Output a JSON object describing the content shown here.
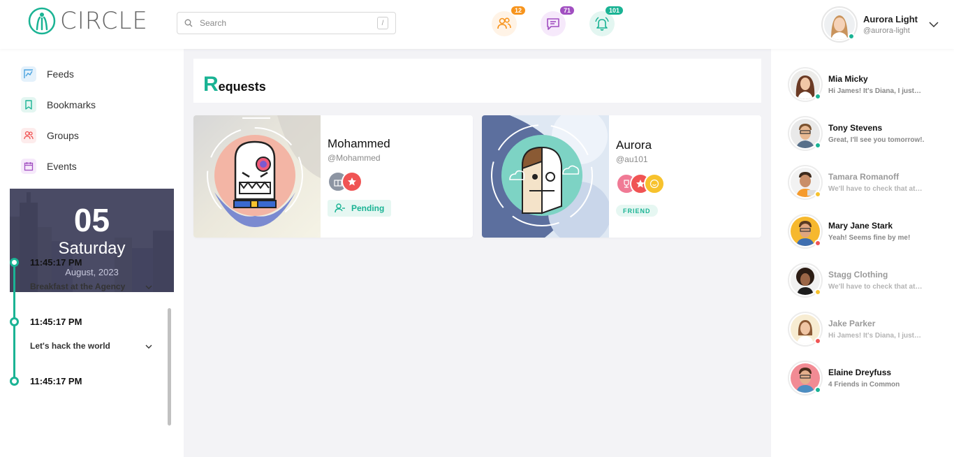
{
  "app": {
    "logo_text": "CIRCLE",
    "brand_color": "#1ab394"
  },
  "search": {
    "placeholder": "Search",
    "shortcut": "/"
  },
  "header_icons": [
    {
      "name": "friends-icon",
      "badge": "12",
      "color": "#f7941d"
    },
    {
      "name": "messages-icon",
      "badge": "71",
      "color": "#a14fc1"
    },
    {
      "name": "notifications-icon",
      "badge": "101",
      "color": "#1ab394"
    }
  ],
  "profile": {
    "name": "Aurora Light",
    "handle": "@aurora-light",
    "status_color": "#1ab394"
  },
  "nav": [
    {
      "label": "Feeds",
      "icon": "feeds-icon"
    },
    {
      "label": "Bookmarks",
      "icon": "bookmark-icon"
    },
    {
      "label": "Groups",
      "icon": "groups-icon"
    },
    {
      "label": "Events",
      "icon": "calendar-icon"
    }
  ],
  "date_card": {
    "day": "05",
    "weekday": "Saturday",
    "month_year": "August, 2023"
  },
  "timeline": [
    {
      "time": "11:45:17 PM",
      "title": "Breakfast at the Agency"
    },
    {
      "time": "11:45:17 PM",
      "title": "Let's hack the world"
    },
    {
      "time": "11:45:17 PM",
      "title": ""
    }
  ],
  "requests": {
    "title_first": "R",
    "title_rest": "equests",
    "cards": [
      {
        "name": "Mohammed",
        "handle": "@Mohammed",
        "status": "Pending"
      },
      {
        "name": "Aurora",
        "handle": "@au101",
        "status": "FRIEND"
      }
    ]
  },
  "contacts": [
    {
      "name": "Mia Micky",
      "message": "Hi James! It's Diana, I just…",
      "status": "online",
      "status_color": "#1ab394",
      "dim": false
    },
    {
      "name": "Tony Stevens",
      "message": "Great, I'll see you tomorrow!.",
      "status": "online",
      "status_color": "#1ab394",
      "dim": false
    },
    {
      "name": "Tamara Romanoff",
      "message": "We'll have to check that at…",
      "status": "away",
      "status_color": "#f7c22d",
      "dim": true
    },
    {
      "name": "Mary Jane Stark",
      "message": "Yeah! Seems fine by me!",
      "status": "busy",
      "status_color": "#f05454",
      "dim": false
    },
    {
      "name": "Stagg Clothing",
      "message": "We'll have to check that at…",
      "status": "away",
      "status_color": "#f7c22d",
      "dim": true
    },
    {
      "name": "Jake Parker",
      "message": "Hi James! It's Diana, I just…",
      "status": "busy",
      "status_color": "#f05454",
      "dim": true
    },
    {
      "name": "Elaine Dreyfuss",
      "message": "4 Friends in Common",
      "status": "online",
      "status_color": "#1ab394",
      "dim": false
    }
  ]
}
